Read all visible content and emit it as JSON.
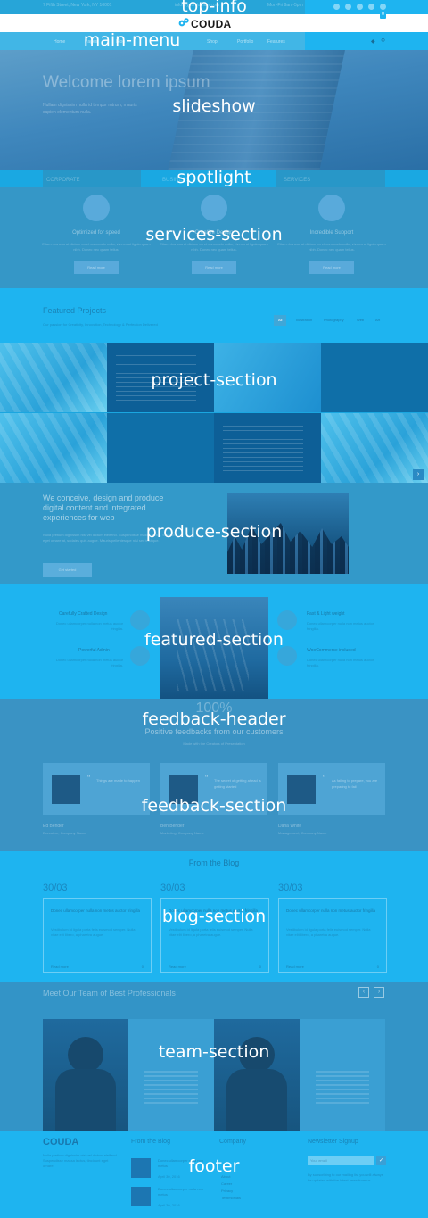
{
  "overlay_labels": {
    "top_info": "top-info",
    "main_menu": "main-menu",
    "slideshow": "slideshow",
    "spotlight": "spotlight",
    "services": "services-section",
    "project": "project-section",
    "produce": "produce-section",
    "featured": "featured-section",
    "feedback_header": "feedback-header",
    "feedback": "feedback-section",
    "blog": "blog-section",
    "team": "team-section",
    "footer": "footer"
  },
  "top_info": {
    "address": "7 Fifth Street, New York, NY 10001",
    "email": "info@yourdomain.com",
    "phone": "Mon-Fri 9am-5pm",
    "cart_count": "0"
  },
  "header": {
    "logo_text": "COUDA",
    "menu": [
      "Home",
      "Pages",
      "Blog",
      "Shop",
      "Portfolio",
      "Features"
    ]
  },
  "slideshow": {
    "headline": "Welcome lorem ipsum",
    "subtext": "Nullam dignissim nulla id tempor rutrum, mauris sapien elementum nulla."
  },
  "spotlight": {
    "items": [
      "CORPORATE",
      "BUSINESS",
      "SERVICES"
    ]
  },
  "services": {
    "items": [
      {
        "title": "Optimized for speed",
        "text": "Etiam rhoncus at dictum eu et commodo nulla, viverra ut ligula quam nibh. Donec nec quam tellus.",
        "button": "Read more"
      },
      {
        "title": "Creative Design",
        "text": "Etiam rhoncus at dictum eu et commodo nulla, viverra ut ligula quam nibh. Donec nec quam tellus.",
        "button": "Read more"
      },
      {
        "title": "Incredible Support",
        "text": "Etiam rhoncus at dictum eu et commodo nulla, viverra ut ligula quam nibh. Donec nec quam tellus.",
        "button": "Read more"
      }
    ]
  },
  "projects": {
    "title": "Featured Projects",
    "desc": "Our passion for Creativity, Innovation, Technology & Perfection Delivered",
    "filters": [
      "All",
      "Illustration",
      "Photography",
      "Web",
      "Art"
    ]
  },
  "produce": {
    "heading": "We conceive, design and produce digital content and integrated experiences for web",
    "body": "Nulla pretium dignissim nisl vel dictum eleifend. Suspendisse massa lectus, tincidunt eget ornare at, sodales quis augue. Mauris pellentesque nisl sed tristique.",
    "button": "Get started"
  },
  "featured": {
    "left": [
      {
        "title": "Carefully Crafted Design",
        "text": "Donec ullamcorper nulla non metus auctor fringilla."
      },
      {
        "title": "Powerful Admin",
        "text": "Donec ullamcorper nulla non metus auctor fringilla."
      }
    ],
    "right": [
      {
        "title": "Fast & Light weight",
        "text": "Donec ullamcorper nulla non metus auctor fringilla."
      },
      {
        "title": "WooCommerce included",
        "text": "Donec ullamcorper nulla non metus auctor fringilla."
      }
    ]
  },
  "feedback": {
    "percent": "100%",
    "title": "Positive feedbacks from our customers",
    "subtitle": "Made with the Creators of Presentation",
    "cards": [
      {
        "quote": "Things are made to happen",
        "name": "Ed Bender",
        "role": "Executive, Company Name"
      },
      {
        "quote": "The secret of getting ahead is getting started",
        "name": "Ben Bender",
        "role": "Marketing, Company Name"
      },
      {
        "quote": "As failing to prepare, you are preparing to fail",
        "name": "Dana White",
        "role": "Management, Company Name"
      }
    ]
  },
  "blog": {
    "title": "From the Blog",
    "posts": [
      {
        "date": "30/03",
        "heading": "Donec ullamcorper nulla non metus auctor fringilla",
        "body": "Vestibulum id ligula porta felis euismod semper. Nulla vitae elit libero, a pharetra augue.",
        "read": "Read more",
        "comments": "0"
      },
      {
        "date": "30/03",
        "heading": "Donec ullamcorper nulla non metus auctor fringilla",
        "body": "Vestibulum id ligula porta felis euismod semper. Nulla vitae elit libero, a pharetra augue.",
        "read": "Read more",
        "comments": "0"
      },
      {
        "date": "30/03",
        "heading": "Donec ullamcorper nulla non metus auctor fringilla",
        "body": "Vestibulum id ligula porta felis euismod semper. Nulla vitae elit libero, a pharetra augue.",
        "read": "Read more",
        "comments": "0"
      }
    ]
  },
  "team": {
    "title": "Meet Our Team of Best Professionals",
    "prev": "‹",
    "next": "›"
  },
  "footer": {
    "brand": "COUDA",
    "brand_text": "Nulla pretium dignissim nisl vel dictum eleifend. Suspendisse massa lectus, tincidunt eget ornare.",
    "col_blog": "From the Blog",
    "posts": [
      {
        "title": "Donec ullamcorper nulla non metus",
        "date": "April 30, 2016"
      },
      {
        "title": "Donec ullamcorper nulla non metus",
        "date": "April 30, 2016"
      }
    ],
    "col_company": "Company",
    "links": [
      "About",
      "Career",
      "Privacy",
      "Testimonials"
    ],
    "col_news": "Newsletter Signup",
    "news_placeholder": "Your email",
    "news_button": "✓",
    "news_text": "By subscribing to our mailing list you will always be updated with the latest news from us."
  }
}
